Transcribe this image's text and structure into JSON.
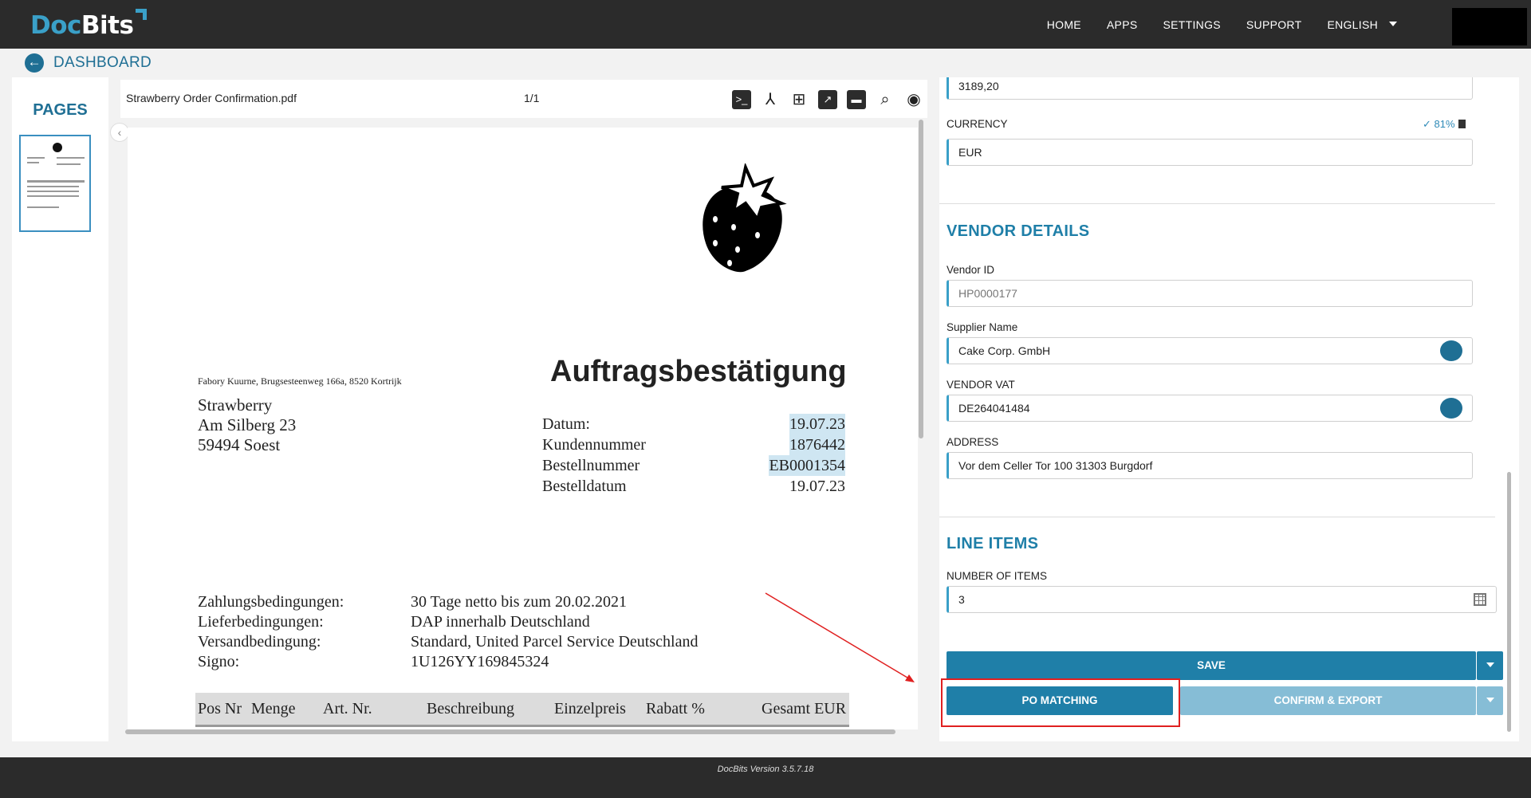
{
  "app": {
    "logo_doc": "Doc",
    "logo_bits": "Bits"
  },
  "nav": {
    "home": "HOME",
    "apps": "APPS",
    "settings": "SETTINGS",
    "support": "SUPPORT",
    "language": "ENGLISH"
  },
  "breadcrumb": {
    "back_icon": "arrow-left-icon",
    "label": "DASHBOARD"
  },
  "pages_panel": {
    "title": "PAGES"
  },
  "viewer": {
    "filename": "Strawberry Order Confirmation.pdf",
    "page_indicator": "1/1",
    "tool_icons": [
      "terminal-icon",
      "merge-icon",
      "tree-icon",
      "chart-icon",
      "folder-icon",
      "search-doc-icon",
      "ocr-icon"
    ]
  },
  "document": {
    "sender_line": "Fabory Kuurne, Brugsesteenweg 166a, 8520 Kortrijk",
    "recipient": [
      "Strawberry",
      "Am Silberg 23",
      "59494 Soest"
    ],
    "title": "Auftragsbestätigung",
    "fields": [
      {
        "label": "Datum:",
        "value": "19.07.23"
      },
      {
        "label": "Kundennummer",
        "value": "1876442"
      },
      {
        "label": "Bestellnummer",
        "value": "EB0001354"
      },
      {
        "label": "Bestelldatum",
        "value": "19.07.23"
      }
    ],
    "terms": [
      {
        "label": "Zahlungsbedingungen:",
        "value": "30 Tage netto bis zum 20.02.2021"
      },
      {
        "label": "Lieferbedingungen:",
        "value": "DAP innerhalb Deutschland"
      },
      {
        "label": "Versandbedingung:",
        "value": "Standard, United Parcel Service Deutschland"
      },
      {
        "label": "Signo:",
        "value": "1U126YY169845324"
      }
    ],
    "table_headers": [
      "Pos Nr",
      "Menge",
      "Art. Nr.",
      "Beschreibung",
      "Einzelpreis",
      "Rabatt %",
      "Gesamt EUR"
    ]
  },
  "form": {
    "amount_value": "3189,20",
    "currency_label": "CURRENCY",
    "currency_confidence": "81%",
    "currency_value": "EUR",
    "vendor_section": "VENDOR DETAILS",
    "vendor_id_label": "Vendor ID",
    "vendor_id_value": "HP0000177",
    "supplier_label": "Supplier Name",
    "supplier_value": "Cake Corp. GmbH",
    "vat_label": "VENDOR VAT",
    "vat_value": "DE264041484",
    "address_label": "ADDRESS",
    "address_value": "Vor dem Celler Tor 100 31303 Burgdorf",
    "line_items_section": "LINE ITEMS",
    "num_items_label": "NUMBER OF ITEMS",
    "num_items_value": "3"
  },
  "actions": {
    "save": "SAVE",
    "po_matching": "PO MATCHING",
    "confirm_export": "CONFIRM & EXPORT"
  },
  "footer": {
    "version": "DocBits Version 3.5.7.18"
  },
  "colors": {
    "accent": "#1f7fa8",
    "topbar": "#2b2b2b",
    "annotation": "#e02020"
  }
}
